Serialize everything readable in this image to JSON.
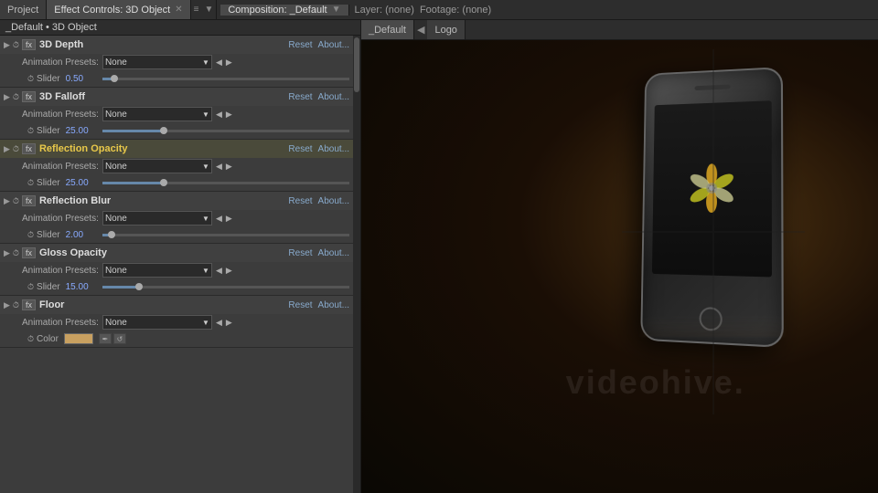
{
  "tabs": {
    "project": "Project",
    "effect_controls": "Effect Controls: 3D Object",
    "composition": "Composition: _Default",
    "layer": "Layer: (none)",
    "footage": "Footage: (none)"
  },
  "breadcrumb": "_Default • 3D Object",
  "comp_tabs": {
    "default": "_Default",
    "logo": "Logo"
  },
  "effects": [
    {
      "name": "3D Depth",
      "highlighted": false,
      "reset": "Reset",
      "about": "About...",
      "presets": "None",
      "slider_value": "0.50",
      "slider_pct": 5
    },
    {
      "name": "3D Falloff",
      "highlighted": false,
      "reset": "Reset",
      "about": "About...",
      "presets": "None",
      "slider_value": "25.00",
      "slider_pct": 25
    },
    {
      "name": "Reflection Opacity",
      "highlighted": true,
      "reset": "Reset",
      "about": "About...",
      "presets": "None",
      "slider_value": "25.00",
      "slider_pct": 25
    },
    {
      "name": "Reflection Blur",
      "highlighted": false,
      "reset": "Reset",
      "about": "About...",
      "presets": "None",
      "slider_value": "2.00",
      "slider_pct": 4
    },
    {
      "name": "Gloss Opacity",
      "highlighted": false,
      "reset": "Reset",
      "about": "About...",
      "presets": "None",
      "slider_value": "15.00",
      "slider_pct": 15
    },
    {
      "name": "Floor",
      "highlighted": false,
      "reset": "Reset",
      "about": "About...",
      "presets": "None",
      "has_color": true,
      "color": "#c8a060"
    }
  ],
  "watermark": "videohive.",
  "labels": {
    "animation_presets": "Animation Presets:",
    "slider": "Slider",
    "color": "Color",
    "none": "None"
  }
}
